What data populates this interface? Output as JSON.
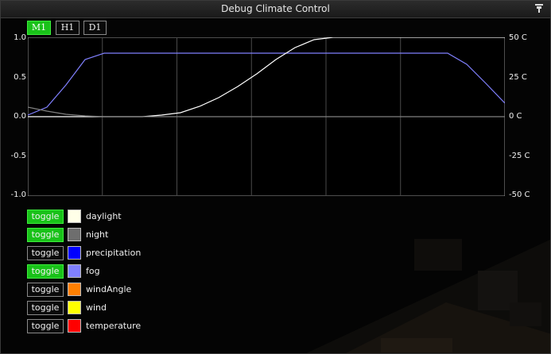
{
  "window": {
    "title": "Debug Climate Control",
    "pin_icon": "pin-icon"
  },
  "modes": [
    {
      "label": "M1",
      "active": true
    },
    {
      "label": "H1",
      "active": false
    },
    {
      "label": "D1",
      "active": false
    }
  ],
  "colors": {
    "toggle_on": "#19c219",
    "panel_bg": "#040404",
    "grid": "#555555"
  },
  "chart_data": {
    "type": "line",
    "x": [
      0,
      4,
      8,
      12,
      16,
      20,
      24,
      28,
      32,
      36,
      40,
      44,
      48,
      52,
      56,
      60,
      64,
      68,
      72,
      76,
      80,
      84,
      88,
      92,
      96,
      100
    ],
    "ylim": [
      -1.0,
      1.0
    ],
    "y2lim": [
      -50,
      50
    ],
    "y_ticks": [
      "1.0",
      "0.5",
      "0.0",
      "-0.5",
      "-1.0"
    ],
    "y2_ticks": [
      "50 C",
      "25 C",
      "0 C",
      "-25 C",
      "-50 C"
    ],
    "grid": true,
    "series": [
      {
        "name": "fog",
        "color": "#8080ff",
        "values": [
          0.02,
          0.12,
          0.4,
          0.72,
          0.8,
          0.8,
          0.8,
          0.8,
          0.8,
          0.8,
          0.8,
          0.8,
          0.8,
          0.8,
          0.8,
          0.8,
          0.8,
          0.8,
          0.8,
          0.8,
          0.8,
          0.8,
          0.8,
          0.66,
          0.42,
          0.17
        ]
      },
      {
        "name": "daylight",
        "color": "#ffffff",
        "values": [
          0.0,
          0.0,
          0.0,
          0.0,
          0.0,
          0.0,
          0.0,
          0.02,
          0.05,
          0.13,
          0.24,
          0.38,
          0.54,
          0.72,
          0.87,
          0.97,
          1.0,
          1.0,
          1.0,
          1.0,
          1.0,
          1.0,
          1.0,
          1.0,
          1.0,
          1.0
        ]
      },
      {
        "name": "night",
        "color": "#808080",
        "values": [
          0.12,
          0.07,
          0.03,
          0.01,
          0.0,
          0.0,
          0.0,
          0.0,
          0.0,
          0.0,
          0.0,
          0.0,
          0.0,
          0.0,
          0.0,
          0.0,
          0.0,
          0.0,
          0.0,
          0.0,
          0.0,
          0.0,
          0.0,
          0.0,
          0.0,
          0.0
        ]
      }
    ]
  },
  "legend": [
    {
      "toggle_label": "toggle",
      "on": true,
      "name": "daylight",
      "color": "#ffffe8"
    },
    {
      "toggle_label": "toggle",
      "on": true,
      "name": "night",
      "color": "#6e6e6e"
    },
    {
      "toggle_label": "toggle",
      "on": false,
      "name": "precipitation",
      "color": "#0000ff"
    },
    {
      "toggle_label": "toggle",
      "on": true,
      "name": "fog",
      "color": "#8080ff"
    },
    {
      "toggle_label": "toggle",
      "on": false,
      "name": "windAngle",
      "color": "#ff8000"
    },
    {
      "toggle_label": "toggle",
      "on": false,
      "name": "wind",
      "color": "#ffff00"
    },
    {
      "toggle_label": "toggle",
      "on": false,
      "name": "temperature",
      "color": "#ff0000"
    }
  ]
}
